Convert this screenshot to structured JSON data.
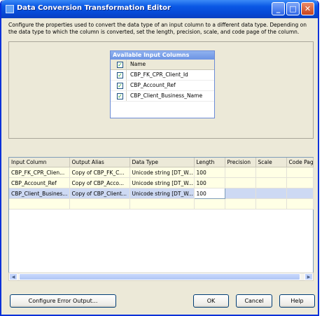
{
  "window": {
    "title": "Data Conversion Transformation Editor"
  },
  "description": "Configure the properties used to convert the data type of an input column to a different data type. Depending on the data type to which the column is converted, set the length, precision, scale, and code page of the column.",
  "available": {
    "title": "Available Input Columns",
    "header": "Name",
    "items": [
      "CBP_FK_CPR_Client_Id",
      "CBP_Account_Ref",
      "CBP_Client_Business_Name"
    ]
  },
  "grid": {
    "columns": [
      "Input Column",
      "Output Alias",
      "Data Type",
      "Length",
      "Precision",
      "Scale",
      "Code Page"
    ],
    "rows": [
      [
        "CBP_FK_CPR_Clien...",
        "Copy of CBP_FK_C...",
        "Unicode string [DT_W...",
        "100",
        "",
        "",
        ""
      ],
      [
        "CBP_Account_Ref",
        "Copy of CBP_Acco...",
        "Unicode string [DT_W...",
        "100",
        "",
        "",
        ""
      ],
      [
        "CBP_Client_Busines...",
        "Copy of CBP_Client...",
        "Unicode string [DT_W...",
        "100",
        "",
        "",
        ""
      ]
    ]
  },
  "buttons": {
    "configure": "Configure Error Output...",
    "ok": "OK",
    "cancel": "Cancel",
    "help": "Help"
  }
}
